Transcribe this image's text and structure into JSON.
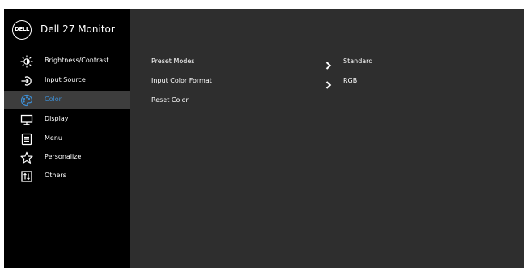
{
  "header": {
    "logo_text": "DELL",
    "title": "Dell 27 Monitor"
  },
  "sidebar": {
    "items": [
      {
        "label": "Brightness/Contrast",
        "icon": "brightness-icon",
        "active": false
      },
      {
        "label": "Input Source",
        "icon": "input-source-icon",
        "active": false
      },
      {
        "label": "Color",
        "icon": "color-palette-icon",
        "active": true
      },
      {
        "label": "Display",
        "icon": "display-icon",
        "active": false
      },
      {
        "label": "Menu",
        "icon": "menu-icon",
        "active": false
      },
      {
        "label": "Personalize",
        "icon": "star-icon",
        "active": false
      },
      {
        "label": "Others",
        "icon": "others-icon",
        "active": false
      }
    ]
  },
  "main": {
    "rows": [
      {
        "label": "Preset Modes",
        "value": "Standard",
        "has_submenu": true
      },
      {
        "label": "Input Color Format",
        "value": "RGB",
        "has_submenu": true
      },
      {
        "label": "Reset Color",
        "value": "",
        "has_submenu": false
      }
    ]
  },
  "colors": {
    "background": "#2e2e2e",
    "sidebar": "#000000",
    "active_item": "#3d3d3d",
    "accent": "#3d8fd6",
    "text": "#ffffff"
  }
}
